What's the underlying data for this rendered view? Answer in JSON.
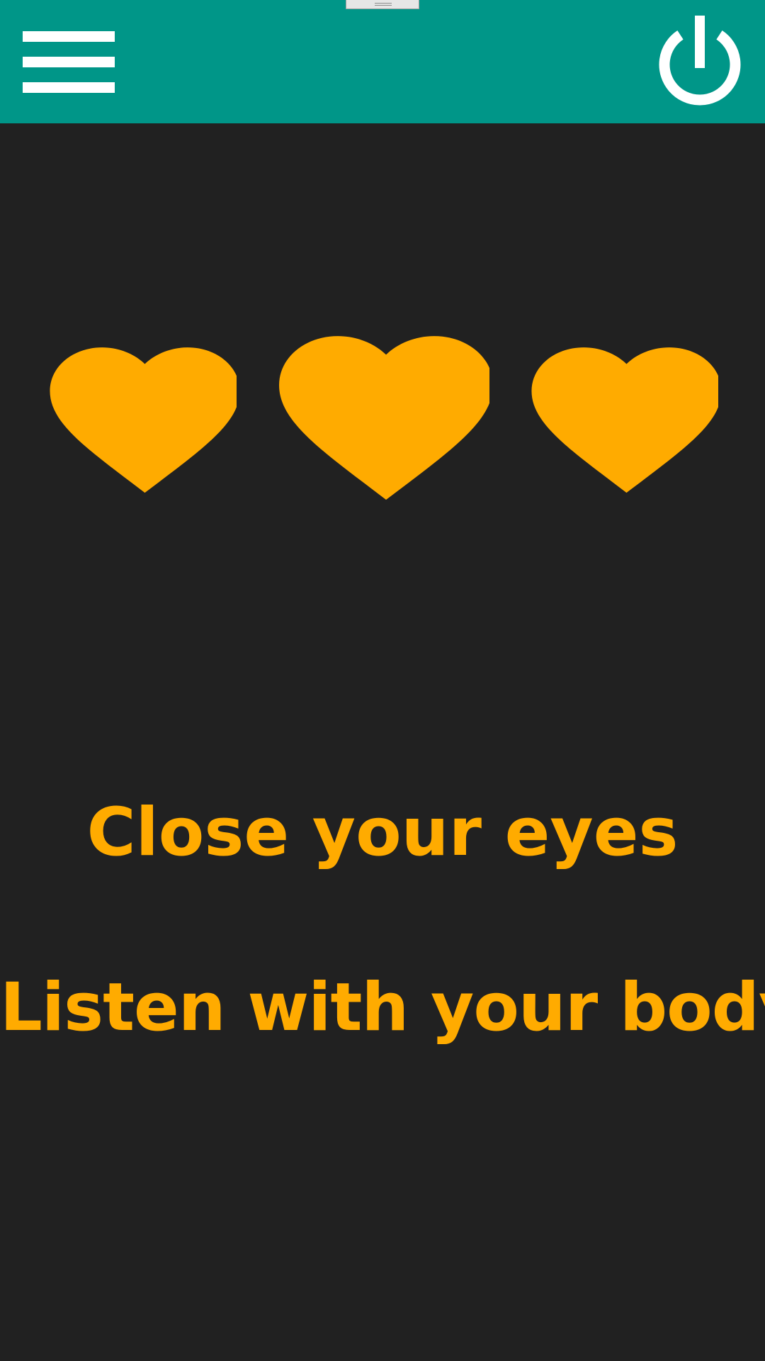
{
  "toolbar": {
    "background_color": "#009688",
    "menu_icon": "hamburger-menu-icon",
    "power_icon": "power-icon"
  },
  "screen": {
    "background_color": "#212121",
    "accent_color": "#ffab00"
  },
  "hearts": {
    "count": 3,
    "icon": "heart-icon",
    "color": "#ffab00"
  },
  "instructions": {
    "line1": "Close your eyes",
    "line2": "Listen with your body"
  }
}
